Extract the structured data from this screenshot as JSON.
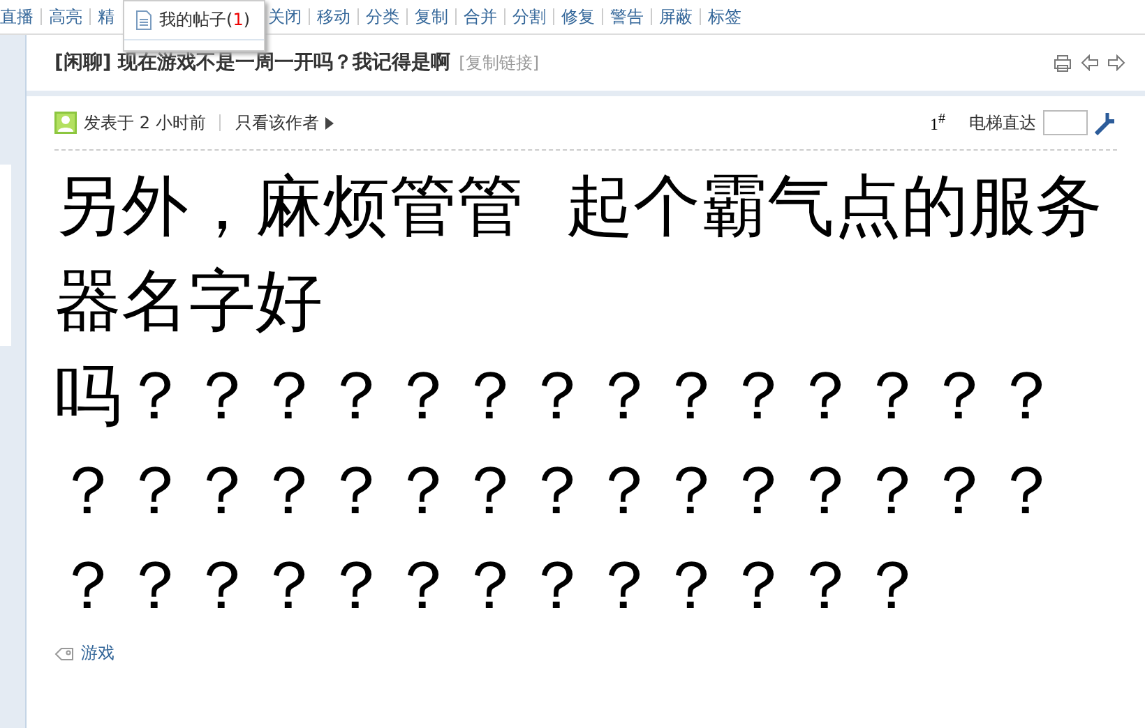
{
  "toolbar": {
    "items": [
      "直播",
      "高亮",
      "精",
      "关闭",
      "移动",
      "分类",
      "复制",
      "合并",
      "分割",
      "修复",
      "警告",
      "屏蔽",
      "标签"
    ]
  },
  "dropdown": {
    "label": "我的帖子(",
    "count": "1",
    "close": ")"
  },
  "thread": {
    "category": "[闲聊]",
    "title": "现在游戏不是一周一开吗？我记得是啊",
    "copy_link": "[复制链接]"
  },
  "post": {
    "posted": "发表于 2 小时前",
    "author_only": "只看该作者",
    "floor": "1",
    "floor_mark": "#",
    "jump_label": "电梯直达",
    "body": [
      "另外，麻烦管管  起个霸气点的服务器名字好",
      "吗？？？？？？？？？？？？？？？？？？？？？？？？？？？？？？？？？？？？？？？？？？"
    ],
    "tag": "游戏"
  }
}
